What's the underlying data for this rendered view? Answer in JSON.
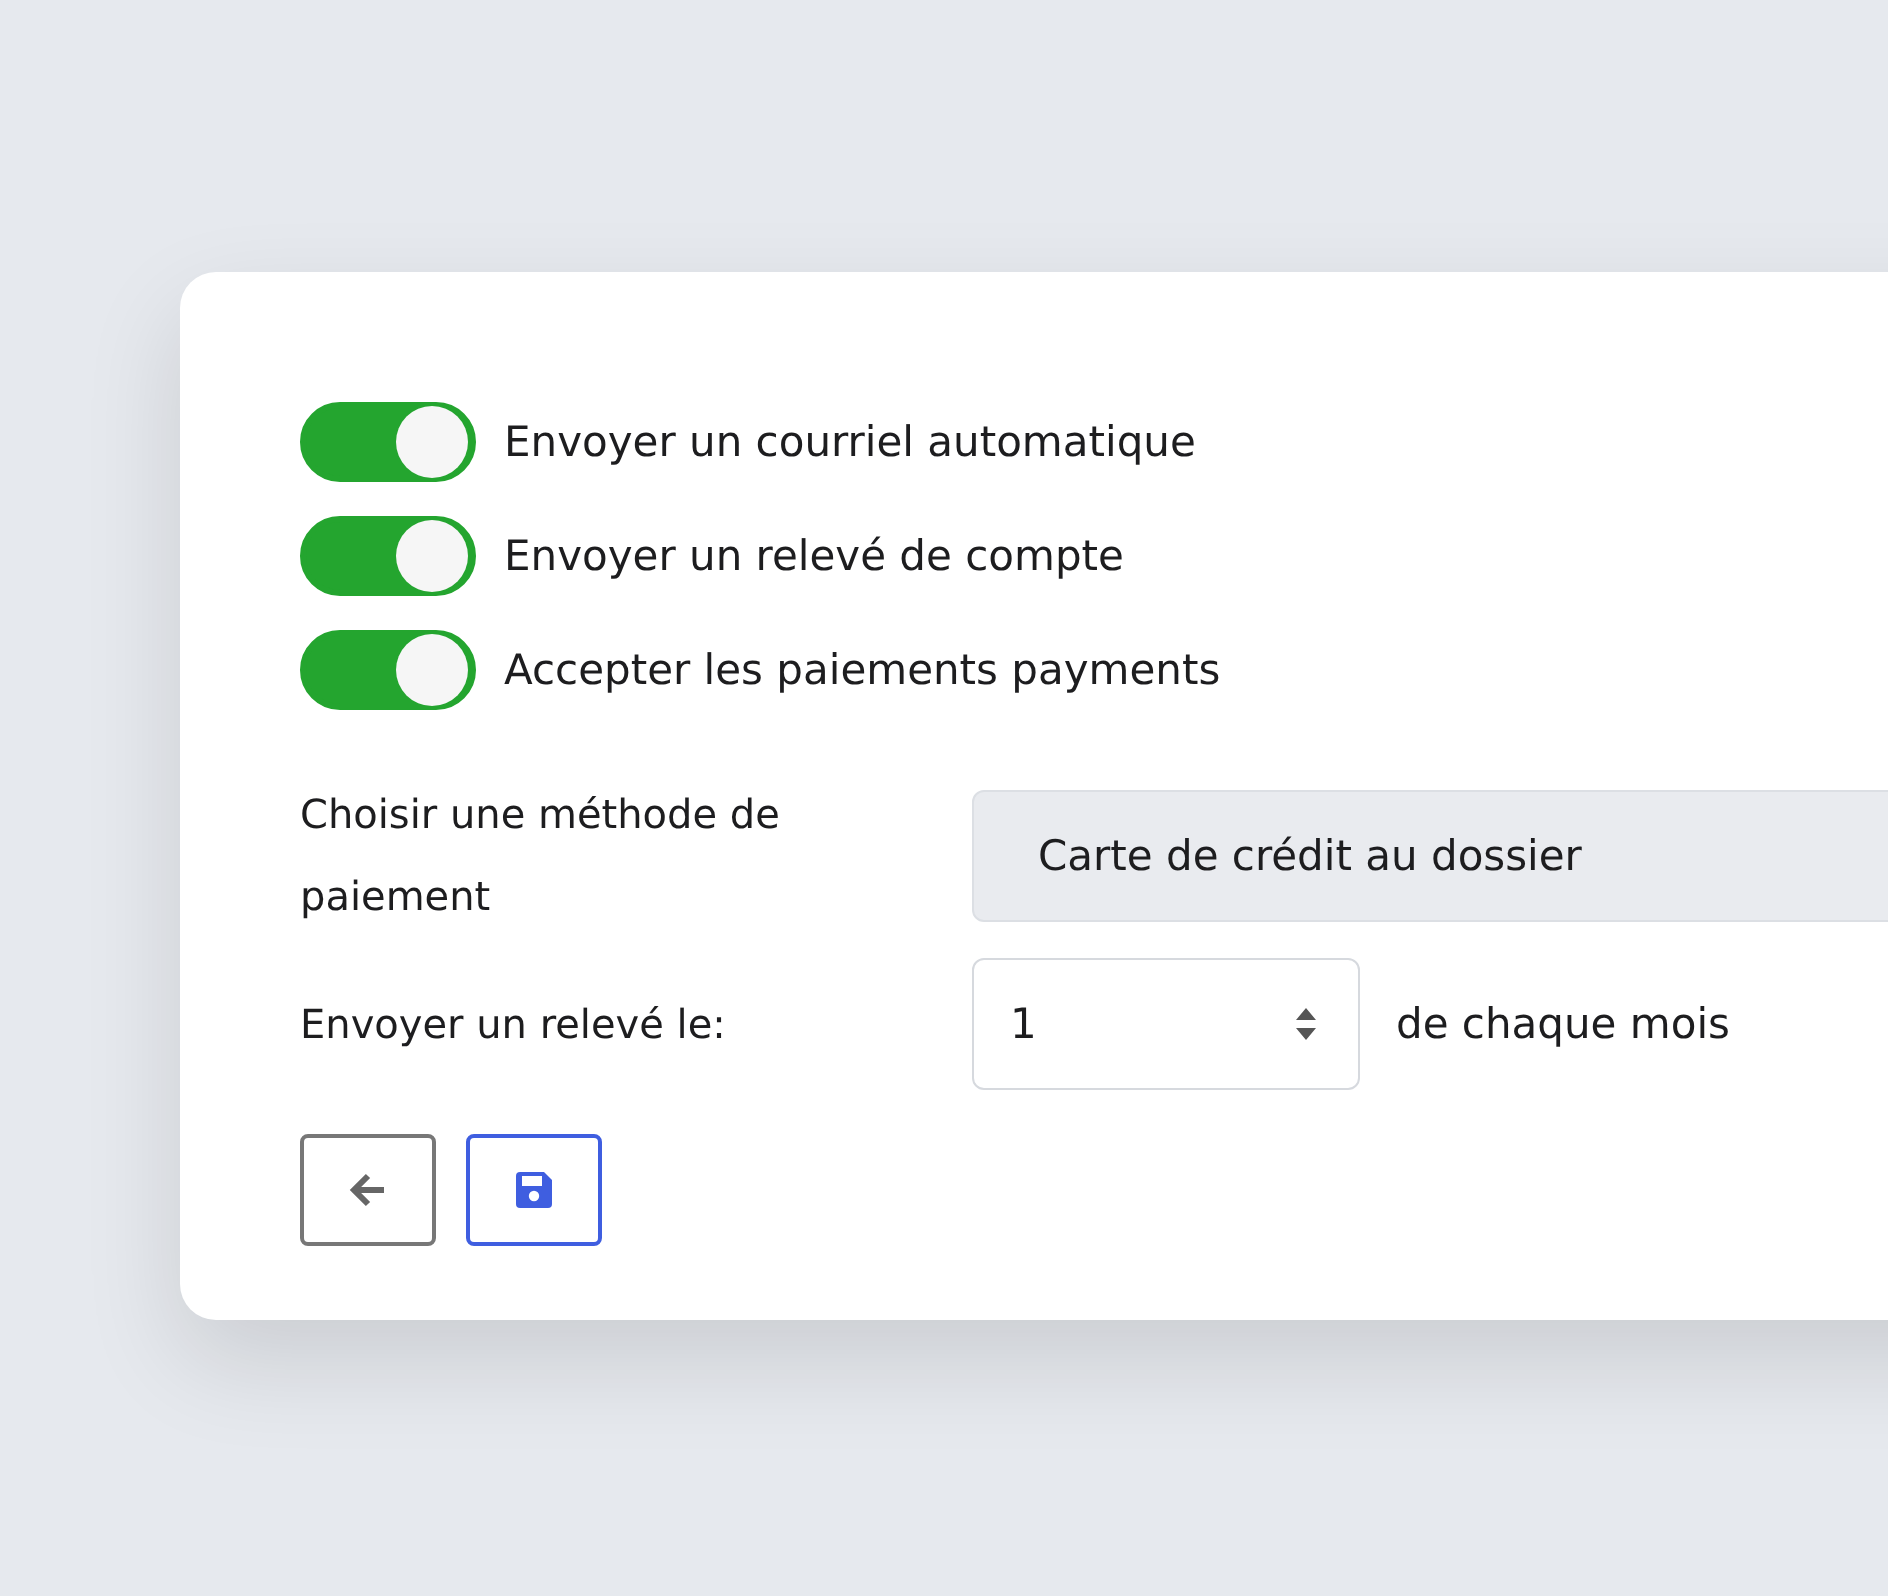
{
  "toggles": [
    {
      "label": "Envoyer un courriel automatique",
      "on": true
    },
    {
      "label": "Envoyer un relevé de compte",
      "on": true
    },
    {
      "label": "Accepter les paiements payments",
      "on": true
    }
  ],
  "payment_method": {
    "label": "Choisir une méthode de paiement",
    "value": "Carte de crédit au dossier"
  },
  "statement_day": {
    "label": "Envoyer un relevé le:",
    "value": "1",
    "suffix": "de chaque mois"
  },
  "buttons": [
    {
      "kind": "back"
    },
    {
      "kind": "save"
    }
  ]
}
